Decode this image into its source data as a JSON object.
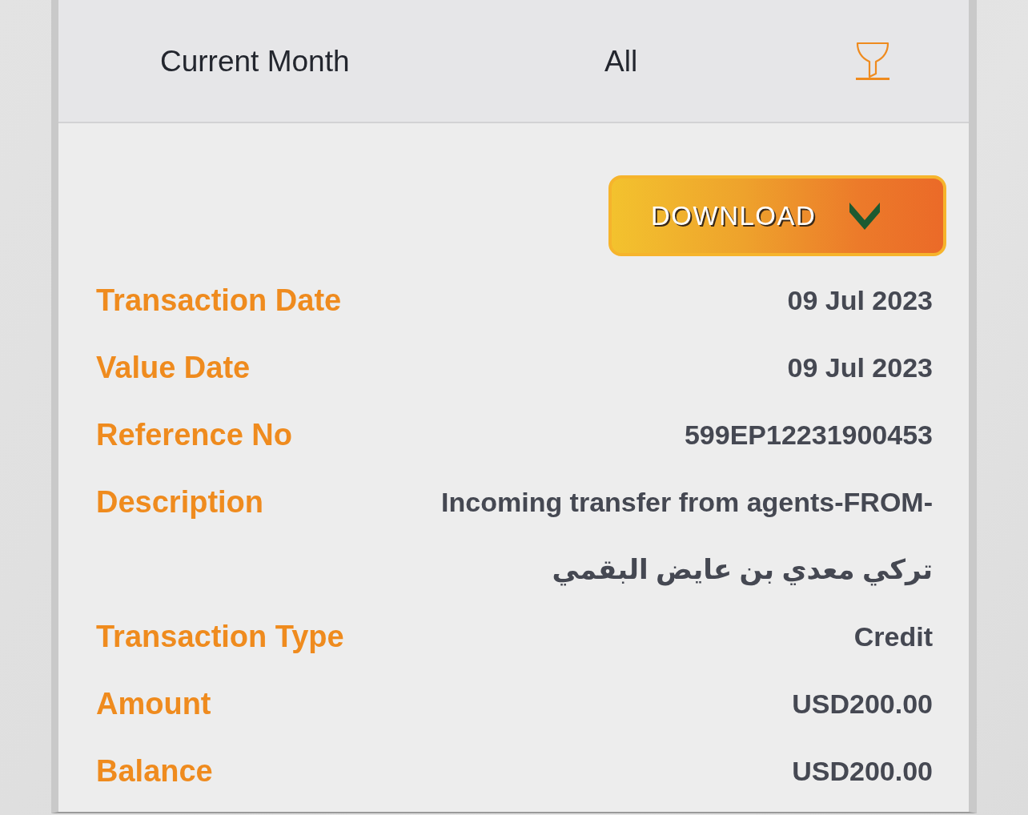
{
  "filter_bar": {
    "period": "Current Month",
    "type": "All"
  },
  "download_button": {
    "label": "DOWNLOAD"
  },
  "details": [
    {
      "label": "Transaction Date",
      "value_lines": [
        "09 Jul 2023"
      ]
    },
    {
      "label": "Value Date",
      "value_lines": [
        "09 Jul 2023"
      ]
    },
    {
      "label": "Reference No",
      "value_lines": [
        "599EP12231900453"
      ]
    },
    {
      "label": "Description",
      "value_lines": [
        "Incoming transfer from agents-FROM-",
        "تركي معدي بن عايض البقمي"
      ]
    },
    {
      "label": "Transaction Type",
      "value_lines": [
        "Credit"
      ]
    },
    {
      "label": "Amount",
      "value_lines": [
        "USD200.00"
      ]
    },
    {
      "label": "Balance",
      "value_lines": [
        "USD200.00"
      ]
    }
  ]
}
